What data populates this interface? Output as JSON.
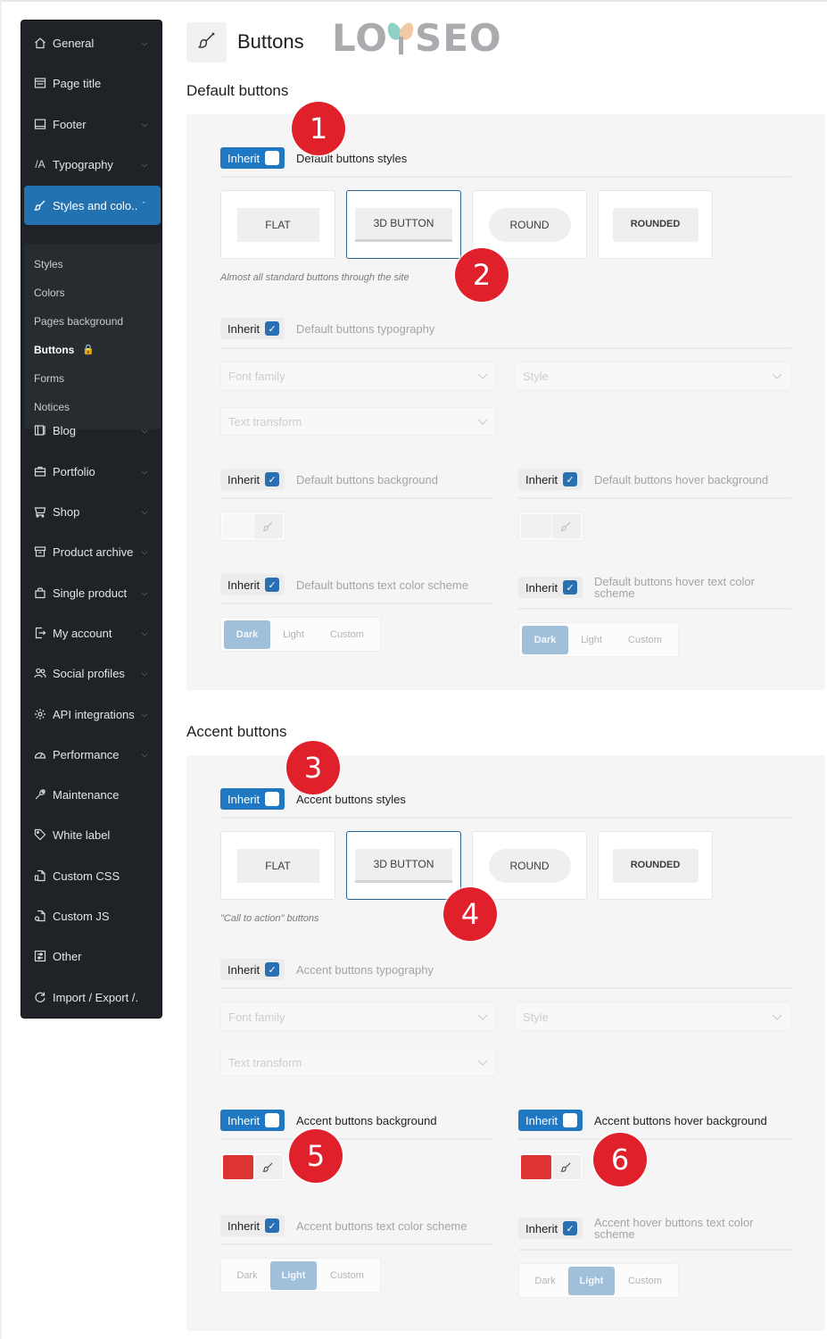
{
  "sidebar": {
    "items": [
      {
        "label": "General",
        "icon": "home-icon",
        "has_chevron": true
      },
      {
        "label": "Page title",
        "icon": "page-title-icon",
        "has_chevron": false
      },
      {
        "label": "Footer",
        "icon": "footer-icon",
        "has_chevron": true
      },
      {
        "label": "Typography",
        "icon": "typography-icon",
        "has_chevron": true
      },
      {
        "label": "Styles and colo...",
        "icon": "brush-icon",
        "has_chevron": true,
        "expanded": true
      },
      {
        "label": "Blog",
        "icon": "blog-icon",
        "has_chevron": true
      },
      {
        "label": "Portfolio",
        "icon": "briefcase-icon",
        "has_chevron": true
      },
      {
        "label": "Shop",
        "icon": "cart-icon",
        "has_chevron": true
      },
      {
        "label": "Product archive",
        "icon": "archive-icon",
        "has_chevron": true
      },
      {
        "label": "Single product",
        "icon": "bag-icon",
        "has_chevron": true
      },
      {
        "label": "My account",
        "icon": "account-login-icon",
        "has_chevron": true
      },
      {
        "label": "Social profiles",
        "icon": "users-icon",
        "has_chevron": true
      },
      {
        "label": "API integrations",
        "icon": "gear-icon",
        "has_chevron": true
      },
      {
        "label": "Performance",
        "icon": "gauge-icon",
        "has_chevron": true
      },
      {
        "label": "Maintenance",
        "icon": "wrench-icon",
        "has_chevron": false
      },
      {
        "label": "White label",
        "icon": "tag-icon",
        "has_chevron": false
      },
      {
        "label": "Custom CSS",
        "icon": "css-file-icon",
        "has_chevron": false
      },
      {
        "label": "Custom JS",
        "icon": "js-file-icon",
        "has_chevron": false
      },
      {
        "label": "Other",
        "icon": "sliders-icon",
        "has_chevron": false
      },
      {
        "label": "Import / Export /...",
        "icon": "refresh-icon",
        "has_chevron": false
      }
    ],
    "subitems": [
      {
        "label": "Styles"
      },
      {
        "label": "Colors"
      },
      {
        "label": "Pages background"
      },
      {
        "label": "Buttons",
        "current": true,
        "locked": true
      },
      {
        "label": "Forms"
      },
      {
        "label": "Notices"
      }
    ]
  },
  "header": {
    "title": "Buttons",
    "icon": "brush-icon",
    "watermark_left": "LO",
    "watermark_right": "SEO"
  },
  "inherit_label": "Inherit",
  "default_section": {
    "title": "Default buttons",
    "styles_label": "Default buttons styles",
    "styles_inherit": false,
    "style_options": [
      "FLAT",
      "3D BUTTON",
      "ROUND",
      "ROUNDED"
    ],
    "selected_style": "3D BUTTON",
    "hint": "Almost all standard buttons through the site",
    "typography_label": "Default buttons typography",
    "typography_inherit": true,
    "font_family_placeholder": "Font family",
    "style_placeholder": "Style",
    "text_transform_placeholder": "Text transform",
    "background_label": "Default buttons background",
    "background_inherit": true,
    "hover_background_label": "Default buttons hover background",
    "hover_background_inherit": true,
    "text_scheme_label": "Default buttons text color scheme",
    "text_scheme_inherit": true,
    "hover_text_scheme_label": "Default buttons hover text color scheme",
    "hover_text_scheme_inherit": true,
    "scheme_options": [
      "Dark",
      "Light",
      "Custom"
    ],
    "text_scheme_selected": "Dark",
    "hover_text_scheme_selected": "Dark"
  },
  "accent_section": {
    "title": "Accent buttons",
    "styles_label": "Accent buttons styles",
    "styles_inherit": false,
    "style_options": [
      "FLAT",
      "3D BUTTON",
      "ROUND",
      "ROUNDED"
    ],
    "selected_style": "3D BUTTON",
    "hint": "\"Call to action\" buttons",
    "typography_label": "Accent buttons typography",
    "typography_inherit": true,
    "font_family_placeholder": "Font family",
    "style_placeholder": "Style",
    "text_transform_placeholder": "Text transform",
    "background_label": "Accent buttons background",
    "background_inherit": false,
    "background_color": "#dd3333",
    "hover_background_label": "Accent buttons hover background",
    "hover_background_inherit": false,
    "hover_background_color": "#dd3333",
    "text_scheme_label": "Accent buttons text color scheme",
    "text_scheme_inherit": true,
    "hover_text_scheme_label": "Accent hover buttons text color scheme",
    "hover_text_scheme_inherit": true,
    "scheme_options": [
      "Dark",
      "Light",
      "Custom"
    ],
    "text_scheme_selected": "Light",
    "hover_text_scheme_selected": "Light"
  },
  "annotations": [
    "1",
    "2",
    "3",
    "4",
    "5",
    "6"
  ],
  "colors": {
    "accent": "#2271b1",
    "sidebar_bg": "#1f2327",
    "marker": "#e0202a",
    "segment_selected": "#9fbfdb"
  }
}
